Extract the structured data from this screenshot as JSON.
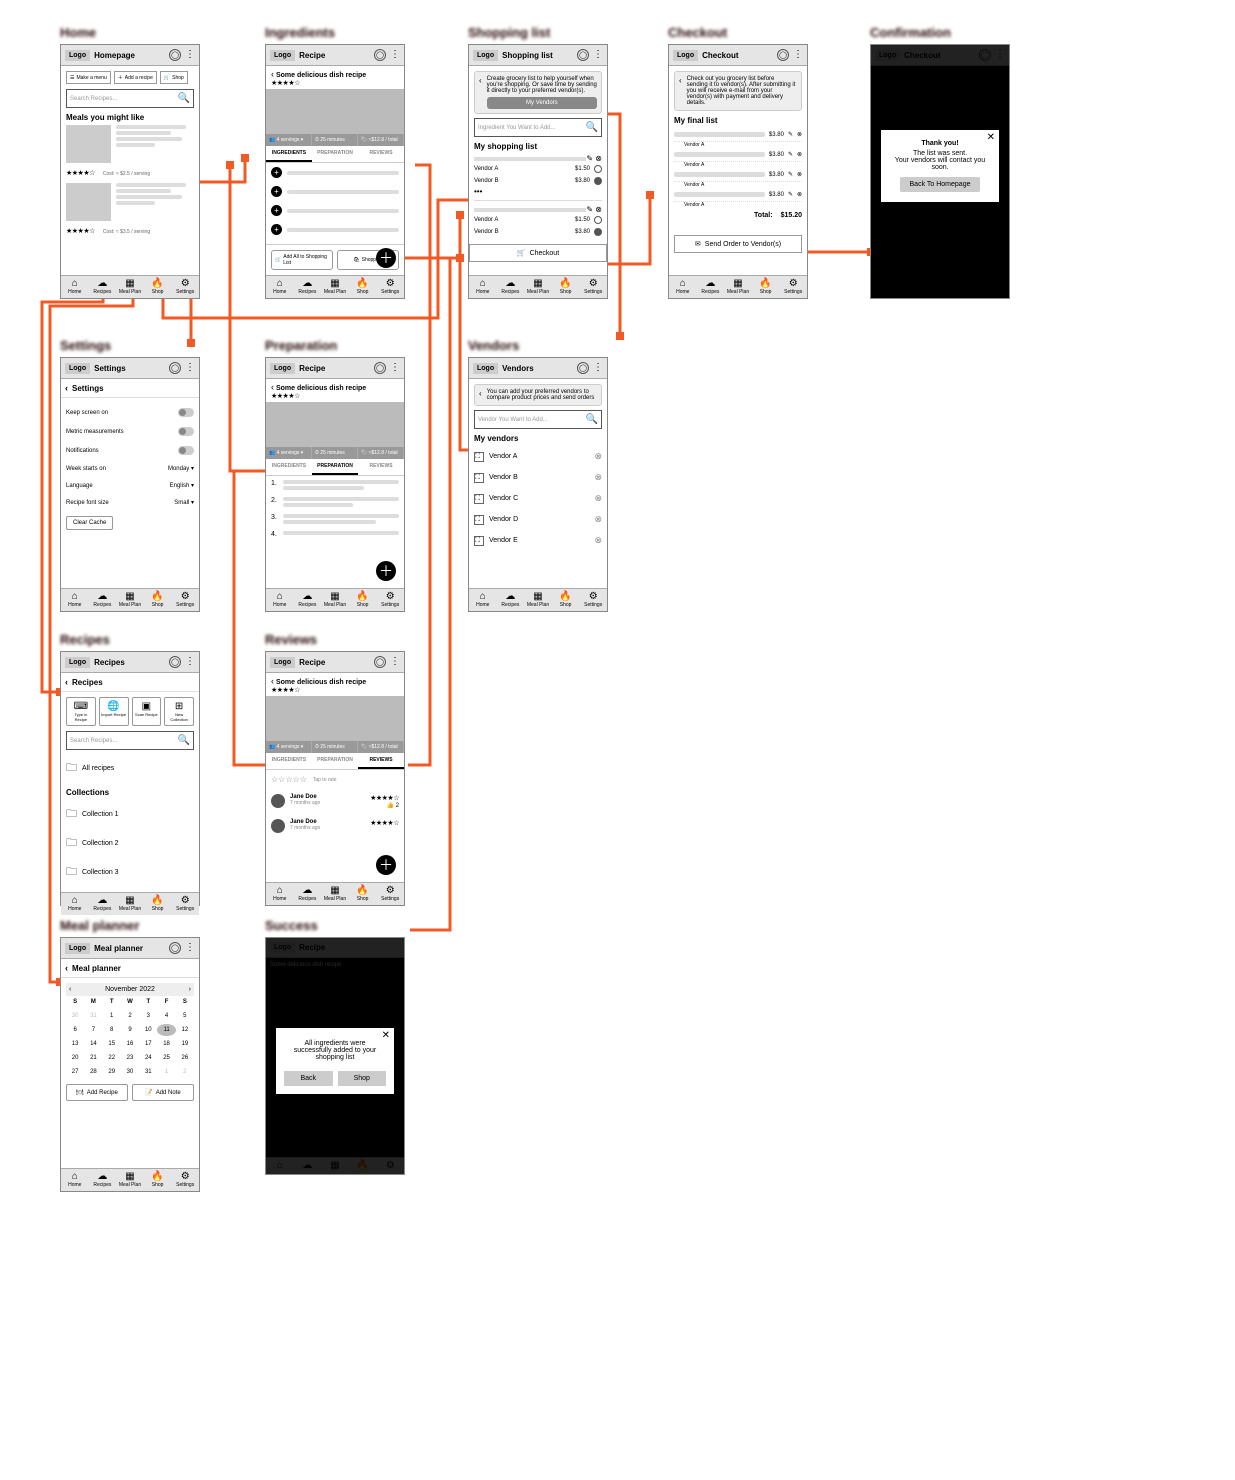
{
  "logo": "Logo",
  "nav": {
    "home": "Home",
    "recipes": "Recipes",
    "mealplan": "Meal Plan",
    "shop": "Shop",
    "settings": "Settings"
  },
  "labels": {
    "home": "Home",
    "ingredients": "Ingredients",
    "shoppingList": "Shopping list",
    "checkout": "Checkout",
    "confirmation": "Confirmation",
    "settings": "Settings",
    "preparation": "Preparation",
    "vendors": "Vendors",
    "recipes": "Recipes",
    "reviews": "Reviews",
    "mealPlanner": "Meal planner",
    "success": "Success"
  },
  "home": {
    "title": "Homepage",
    "chips": {
      "makeMenu": "Make a menu",
      "addRecipe": "Add a recipe",
      "shop": "Shop"
    },
    "searchPlaceholder": "Search Recipes...",
    "mealsHeading": "Meals you might like",
    "cost1": "Cost: ≈ $2.5 / serving",
    "cost2": "Cost: ≈ $3.5 / serving"
  },
  "recipe": {
    "title": "Recipe",
    "name": "Some delicious dish recipe",
    "servingsLabel": "4 servings",
    "timeLabel": "25 minutes",
    "costLabel": "≈$12.8 / total",
    "tabs": {
      "ingredients": "INGREDIENTS",
      "preparation": "PREPARATION",
      "reviews": "REVIEWS"
    },
    "addAll": "Add All to Shopping List",
    "shopping": "Shopping"
  },
  "reviews": {
    "tapToRate": "Tap to rate",
    "name": "Jane Doe",
    "date": "7 months ago",
    "likes": "2"
  },
  "success": {
    "message": "All ingredients were successfully added to your shopping list",
    "back": "Back",
    "shop": "Shop"
  },
  "shoppingList": {
    "title": "Shopping list",
    "info": "Create grocery list to help yourself when you're shopping. Or save time by sending it directly to your preferred vendor(s).",
    "myVendors": "My Vendors",
    "searchPlaceholder": "Ingredient You Want to Add...",
    "heading": "My shopping list",
    "vendorA": "Vendor A",
    "vendorB": "Vendor B",
    "priceA": "$1.50",
    "priceB": "$3.80",
    "checkout": "Checkout"
  },
  "checkout": {
    "title": "Checkout",
    "info": "Check out you grocery list before sending it to vendor(s). After submitting it you will receive e-mail from your vendor(s) with payment and delivery details.",
    "heading": "My final list",
    "vendor": "Vendor A",
    "price": "$3.80",
    "totalLabel": "Total:",
    "totalValue": "$15.20",
    "send": "Send Order to Vendor(s)"
  },
  "confirmation": {
    "title": "Thank you!",
    "line1": "The list was sent.",
    "line2": "Your vendors will contact you soon.",
    "button": "Back To Homepage"
  },
  "settings": {
    "title": "Settings",
    "subheader": "Settings",
    "keepScreen": "Keep screen on",
    "metric": "Metric measurements",
    "notifications": "Notifications",
    "weekStarts": "Week starts on",
    "weekVal": "Monday",
    "language": "Language",
    "langVal": "English",
    "fontSize": "Recipe font size",
    "fontVal": "Small",
    "clearCache": "Clear Cache"
  },
  "vendors": {
    "title": "Vendors",
    "info": "You can add your preferred vendors to compare product prices and send orders",
    "searchPlaceholder": "Vendor You Want to Add...",
    "heading": "My vendors",
    "list": [
      "Vendor A",
      "Vendor B",
      "Vendor C",
      "Vendor D",
      "Vendor E"
    ]
  },
  "recipes": {
    "title": "Recipes",
    "subheader": "Recipes",
    "actions": {
      "type": "Type in Recipe",
      "import": "Import Recipe",
      "scan": "Scan Recipe",
      "collection": "New Collection"
    },
    "allRecipes": "All recipes",
    "collectionsHeading": "Collections",
    "collections": [
      "Collection 1",
      "Collection 2",
      "Collection 3"
    ]
  },
  "mealPlanner": {
    "title": "Meal planner",
    "subheader": "Meal planner",
    "month": "November 2022",
    "dayHeaders": [
      "S",
      "M",
      "T",
      "W",
      "T",
      "F",
      "S"
    ],
    "addRecipe": "Add Recipe",
    "addNote": "Add Note"
  }
}
